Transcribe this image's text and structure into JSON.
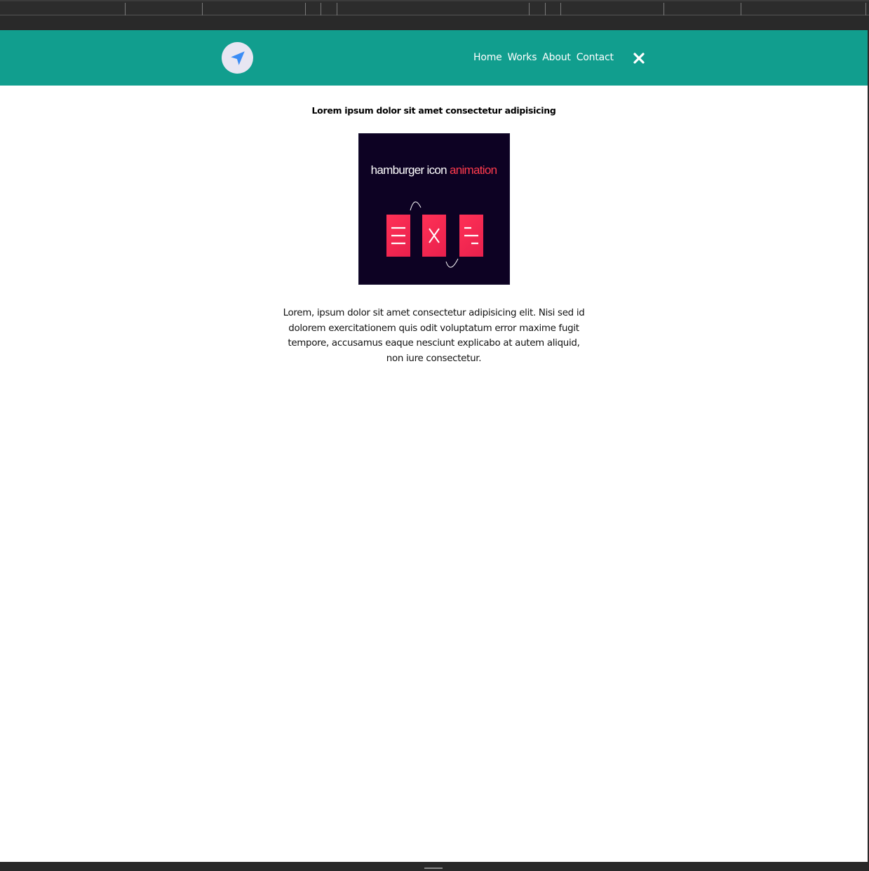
{
  "nav": {
    "links": [
      {
        "label": "Home"
      },
      {
        "label": "Works"
      },
      {
        "label": "About"
      },
      {
        "label": "Contact"
      }
    ],
    "logo_icon": "navigation-arrow-icon",
    "close_icon": "close-icon"
  },
  "main": {
    "headline": "Lorem ipsum dolor sit amet consectetur adipisicing",
    "image": {
      "title_white": "hamburger icon",
      "title_red": "animation"
    },
    "paragraph": "Lorem, ipsum dolor sit amet consectetur adipisicing elit. Nisi sed id dolorem exercitationem quis odit voluptatum error maxime fugit tempore, accusamus eaque nesciunt explicabo at autem aliquid, non iure consectetur."
  },
  "colors": {
    "navbar": "#119e8e",
    "logo_bg": "#e8e6f2",
    "logo_arrow": "#3b8cf5",
    "image_bg": "#0d0223",
    "image_accent": "#ff3156"
  }
}
